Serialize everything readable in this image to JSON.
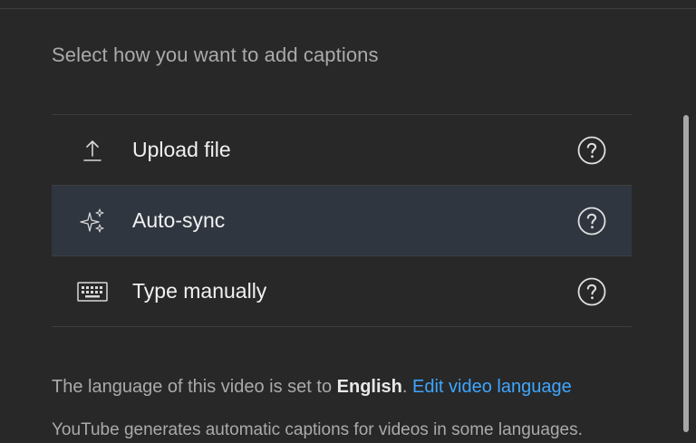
{
  "dialog": {
    "heading": "Select how you want to add captions",
    "options": [
      {
        "label": "Upload file",
        "icon": "upload-icon",
        "selected": false
      },
      {
        "label": "Auto-sync",
        "icon": "sparkle-icon",
        "selected": true
      },
      {
        "label": "Type manually",
        "icon": "keyboard-icon",
        "selected": false
      }
    ],
    "help_icon": "help-circle-icon",
    "language": {
      "prefix": "The language of this video is set to ",
      "value": "English",
      "separator": ". ",
      "edit_link": "Edit video language"
    },
    "auto_caption_note": "YouTube generates automatic captions for videos in some languages."
  },
  "colors": {
    "background": "#282828",
    "selected_row": "#2f3640",
    "link": "#3ea6ff",
    "text_primary": "#f1f1f1",
    "text_secondary": "#aaaaaa"
  }
}
